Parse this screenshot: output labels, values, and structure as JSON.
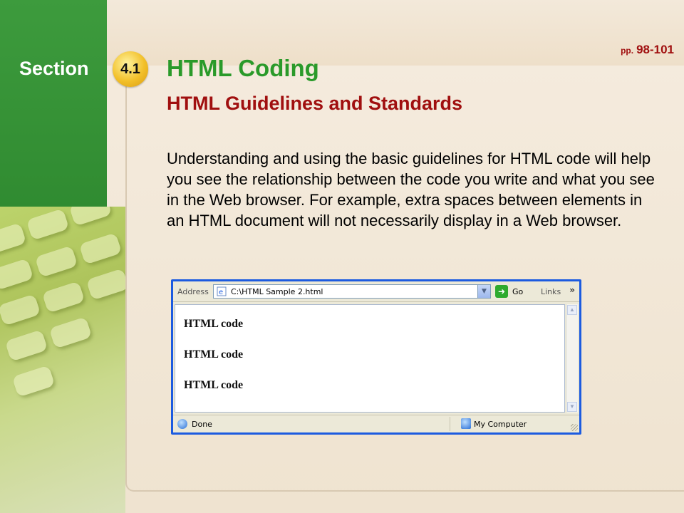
{
  "header": {
    "section_label": "Section",
    "section_number": "4.1",
    "pages_prefix": "pp.",
    "pages_range": "98-101"
  },
  "slide": {
    "title": "HTML Coding",
    "subtitle": "HTML Guidelines and Standards",
    "body": "Understanding and using the basic guidelines for HTML code will help you see the relationship between the code you write and what you see in the Web browser. For example, extra spaces between elements in an HTML document will not necessarily display in a Web browser."
  },
  "browser": {
    "address_label": "Address",
    "address_value": "C:\\HTML Sample 2.html",
    "go_label": "Go",
    "links_label": "Links",
    "chevron": "»",
    "content_lines": [
      "HTML code",
      "HTML code",
      "HTML code"
    ],
    "status_text": "Done",
    "zone_text": "My Computer"
  },
  "colors": {
    "title_green": "#2a9a2a",
    "subtitle_red": "#a00f0f",
    "sidebar_green": "#3d9b3d",
    "badge_yellow": "#f2c02a",
    "browser_frame_blue": "#1c5be0"
  },
  "icons": {
    "address_icon": "ie-page-icon",
    "go_icon": "green-arrow-icon",
    "dropdown_icon": "chevron-down-icon",
    "status_icon": "ie-globe-icon",
    "zone_icon": "my-computer-icon"
  }
}
